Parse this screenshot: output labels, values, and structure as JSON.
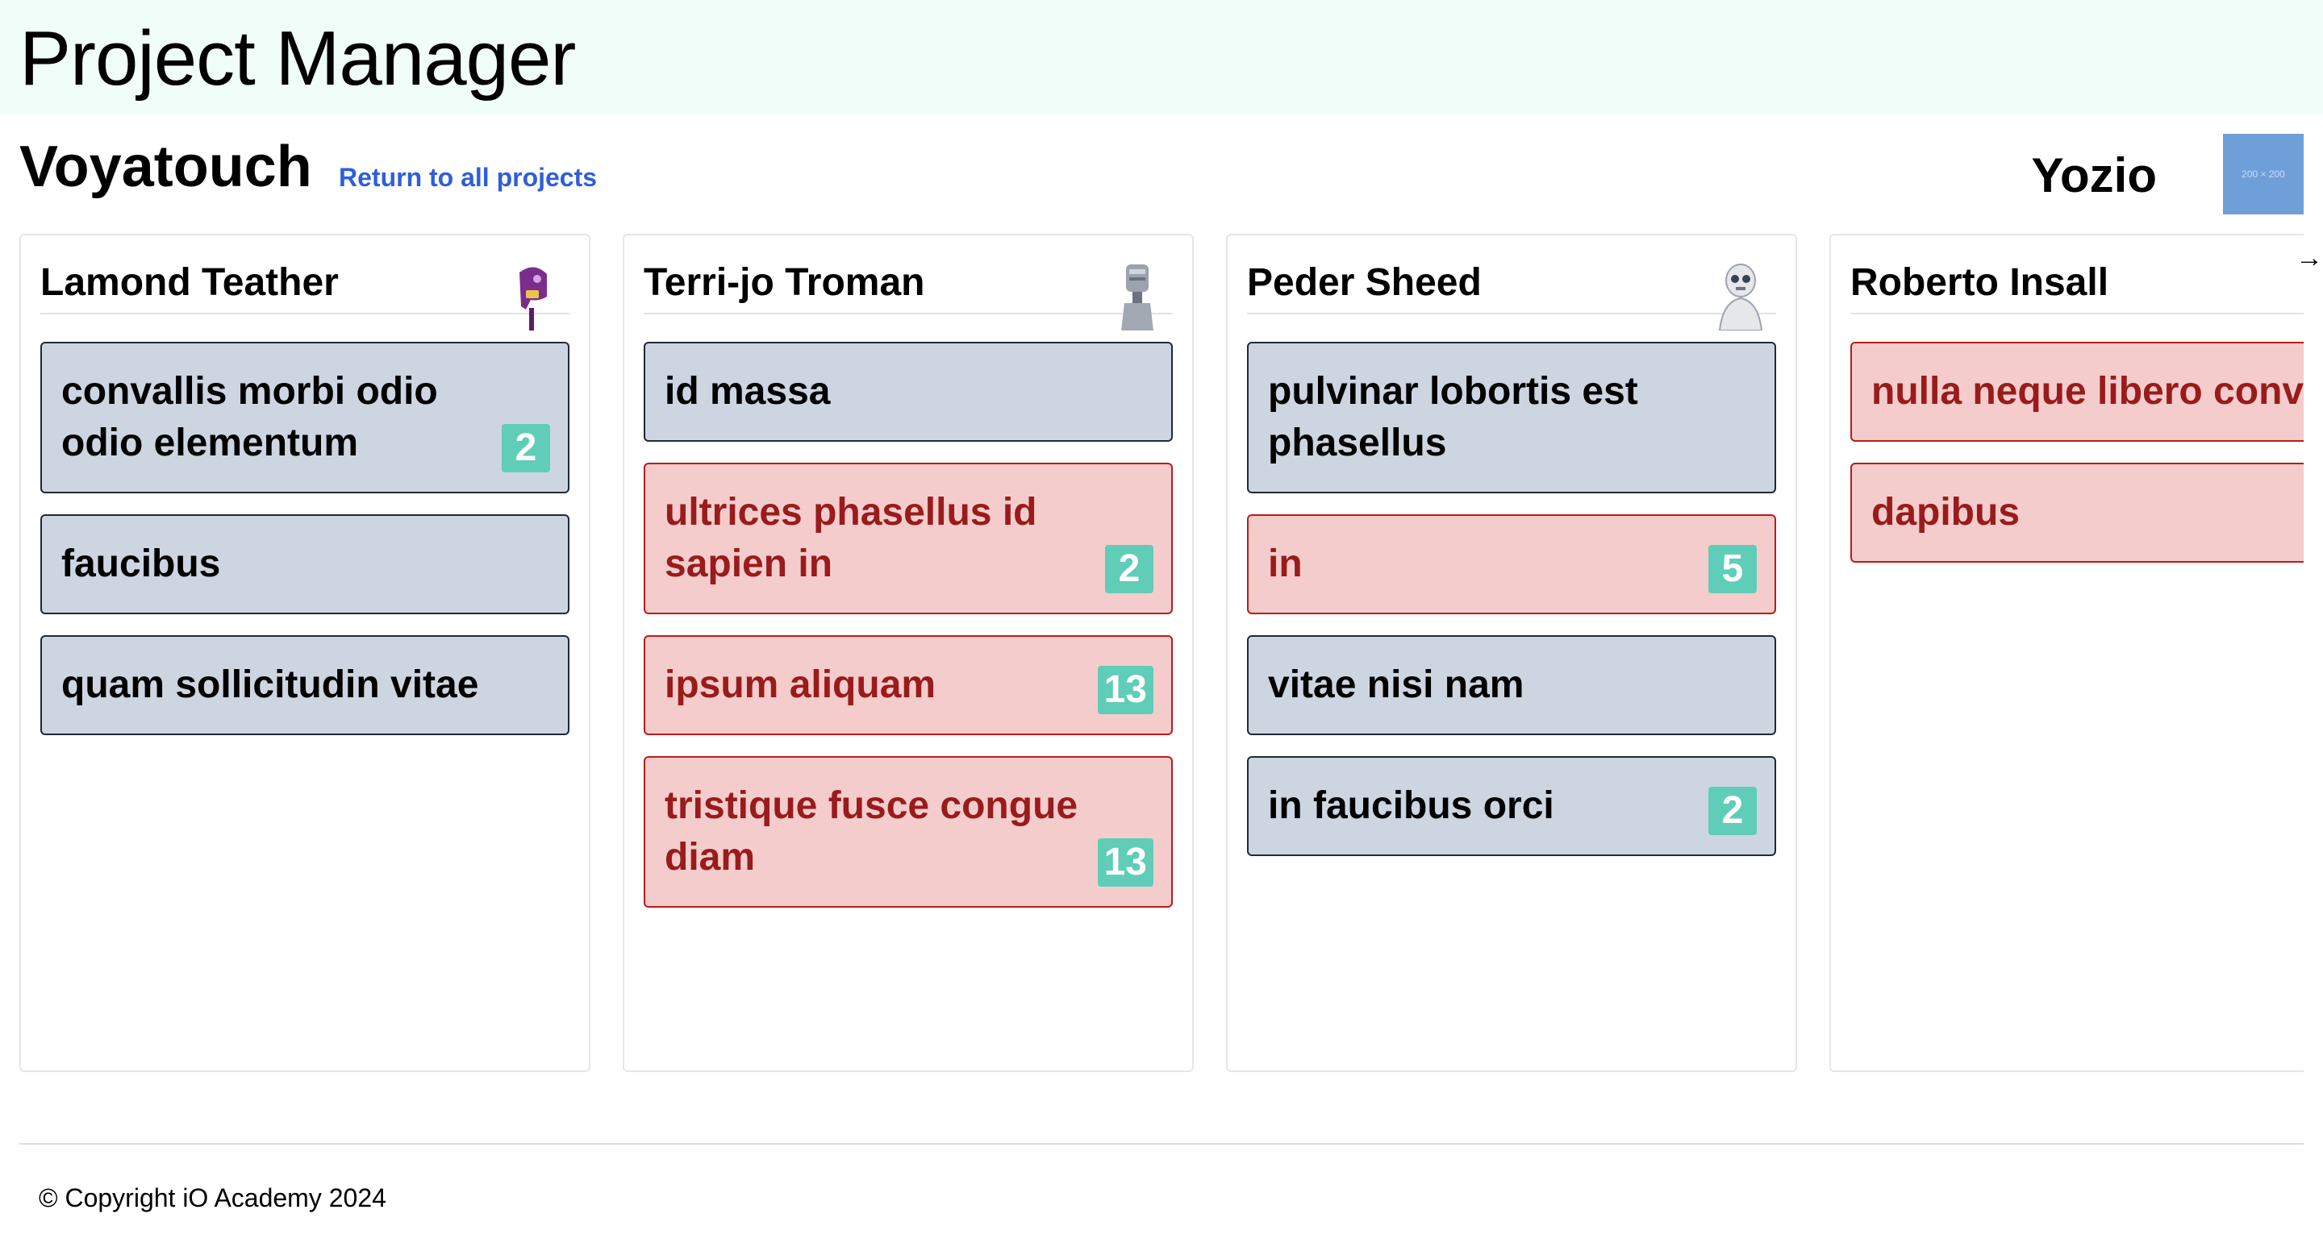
{
  "app": {
    "title": "Project Manager"
  },
  "project": {
    "name": "Voyatouch",
    "return_link": "Return to all projects",
    "client_name": "Yozio",
    "client_logo_text": "200 × 200"
  },
  "columns": [
    {
      "name": "Lamond Teather",
      "avatar_icon": "purple-robot-avatar-icon",
      "tasks": [
        {
          "title": "convallis morbi odio odio elementum",
          "badge": "2",
          "overdue": false
        },
        {
          "title": "faucibus",
          "badge": "",
          "overdue": false
        },
        {
          "title": "quam sollicitudin vitae",
          "badge": "",
          "overdue": false
        }
      ]
    },
    {
      "name": "Terri-jo Troman",
      "avatar_icon": "grey-robot-avatar-icon",
      "tasks": [
        {
          "title": "id massa",
          "badge": "",
          "overdue": false
        },
        {
          "title": "ultrices phasellus id sapien in",
          "badge": "2",
          "overdue": true
        },
        {
          "title": "ipsum aliquam",
          "badge": "13",
          "overdue": true
        },
        {
          "title": "tristique fusce congue diam",
          "badge": "13",
          "overdue": true
        }
      ]
    },
    {
      "name": "Peder Sheed",
      "avatar_icon": "white-robot-avatar-icon",
      "tasks": [
        {
          "title": "pulvinar lobortis est phasellus",
          "badge": "",
          "overdue": false
        },
        {
          "title": "in",
          "badge": "5",
          "overdue": true
        },
        {
          "title": "vitae nisi nam",
          "badge": "",
          "overdue": false
        },
        {
          "title": "in faucibus orci",
          "badge": "2",
          "overdue": false
        }
      ]
    },
    {
      "name": "Roberto Insall",
      "avatar_icon": "",
      "tasks": [
        {
          "title": "nulla neque libero convallis",
          "badge": "",
          "overdue": true
        },
        {
          "title": "dapibus",
          "badge": "",
          "overdue": true
        }
      ]
    }
  ],
  "scroll_arrow": "→",
  "footer": {
    "copyright": "© Copyright iO Academy 2024"
  },
  "colors": {
    "header_bg": "#f0fdf8",
    "link": "#2f5fd8",
    "card_normal_bg": "#cdd5e1",
    "card_overdue_bg": "#f5cccc",
    "card_overdue_text": "#991b1b",
    "badge_bg": "#5fcdb8"
  }
}
